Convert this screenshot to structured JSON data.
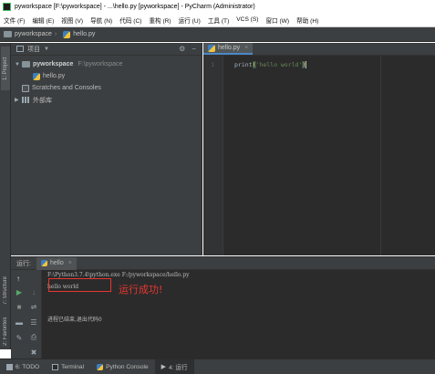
{
  "window": {
    "title": "pyworkspace [F:\\pyworkspace] - ...\\hello.py [pyworkspace] - PyCharm (Administrator)"
  },
  "menu": {
    "items": [
      "文件 (F)",
      "编辑 (E)",
      "视图 (V)",
      "导航 (N)",
      "代码 (C)",
      "重构 (R)",
      "运行 (U)",
      "工具 (T)",
      "VCS (S)",
      "窗口 (W)",
      "帮助 (H)"
    ]
  },
  "breadcrumb": {
    "project": "pyworkspace",
    "file": "hello.py"
  },
  "left_strip": {
    "project_tab": "1: Project",
    "structure_tab": "7: Structure",
    "favorites_tab": "2: Favorites"
  },
  "project_panel": {
    "header_label": "项目",
    "tree": {
      "root_name": "pyworkspace",
      "root_path": "F:\\pyworkspace",
      "file": "hello.py",
      "scratches": "Scratches and Consoles",
      "external": "外部库"
    }
  },
  "editor": {
    "tab_label": "hello.py",
    "line_number": "1",
    "code_prefix": "print",
    "code_string": "'hello world'"
  },
  "run_panel": {
    "label": "运行:",
    "tab_label": "hello",
    "console": {
      "command": "F:\\Python3.7.4\\python.exe F:/pyworkspace/hello.py",
      "output": "hello world",
      "exit": "进程已结束,退出代码0"
    },
    "annotation": "运行成功!"
  },
  "status_bar": {
    "todo": "6: TODO",
    "terminal": "Terminal",
    "python_console": "Python Console",
    "run": "4: 运行"
  },
  "colors": {
    "highlight": "#e6372f",
    "accent": "#4a88c7",
    "string": "#6a8759"
  }
}
